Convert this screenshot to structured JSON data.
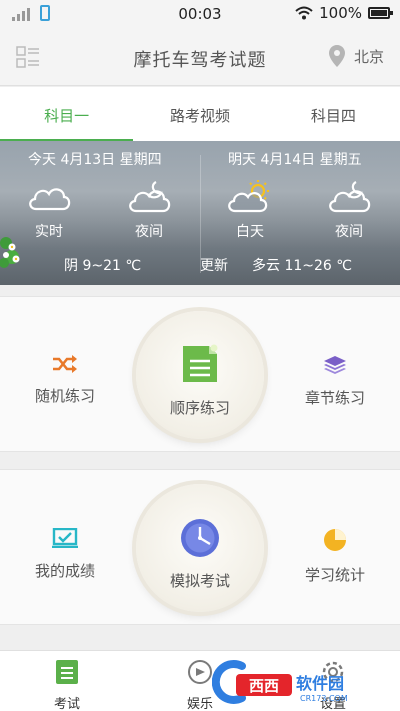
{
  "status_bar": {
    "time": "00:03",
    "battery": "100%"
  },
  "header": {
    "title": "摩托车驾考试题",
    "location": "北京"
  },
  "tabs": [
    {
      "label": "科目一",
      "active": true
    },
    {
      "label": "路考视频",
      "active": false
    },
    {
      "label": "科目四",
      "active": false
    }
  ],
  "weather": {
    "today": {
      "date": "今天 4月13日 星期四",
      "now_label": "实时",
      "night_label": "夜间",
      "summary": "阴 9~21 ℃"
    },
    "tomorrow": {
      "date": "明天 4月14日 星期五",
      "day_label": "白天",
      "night_label": "夜间",
      "summary": "多云 11~26 ℃"
    },
    "update_label": "更新"
  },
  "practice": {
    "random": "随机练习",
    "sequential": "顺序练习",
    "chapter": "章节练习"
  },
  "exam": {
    "scores": "我的成绩",
    "mock": "模拟考试",
    "stats": "学习统计"
  },
  "bottom_nav": [
    {
      "label": "考试"
    },
    {
      "label": "娱乐"
    },
    {
      "label": "设置"
    }
  ],
  "watermark": {
    "brand": "西西",
    "site_name": "软件园",
    "url": "CR173.COM"
  },
  "colors": {
    "accent": "#4bae4f",
    "orange": "#e8792a",
    "purple": "#7a5fc7",
    "teal": "#27b7c7",
    "yellow": "#f3b322",
    "clock_blue": "#6b7fe2"
  }
}
